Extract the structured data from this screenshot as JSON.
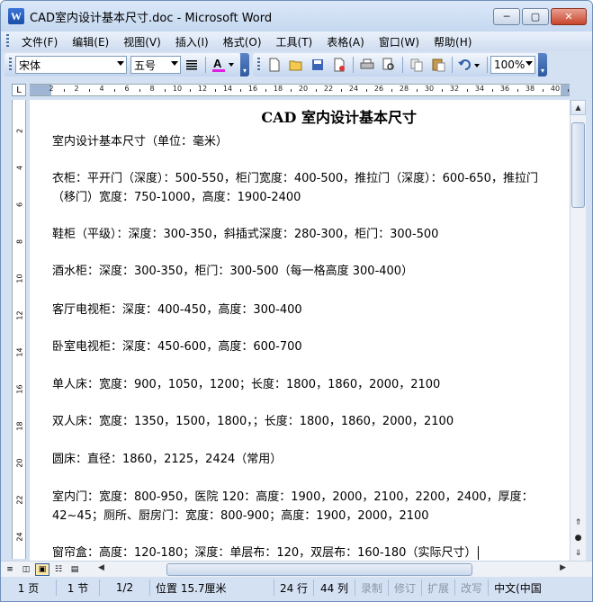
{
  "window": {
    "title": "CAD室内设计基本尺寸.doc - Microsoft Word",
    "app_icon_letter": "W",
    "minimize": "─",
    "maximize": "▢",
    "close": "✕"
  },
  "menu": {
    "items": [
      "文件(F)",
      "编辑(E)",
      "视图(V)",
      "插入(I)",
      "格式(O)",
      "工具(T)",
      "表格(A)",
      "窗口(W)",
      "帮助(H)"
    ],
    "more": "▾"
  },
  "toolbar": {
    "font": "宋体",
    "size": "五号",
    "zoom": "100%",
    "font_color": "#e020e0"
  },
  "ruler": {
    "numbers": [
      "2",
      "2",
      "4",
      "6",
      "8",
      "10",
      "12",
      "14",
      "16",
      "18",
      "20",
      "22",
      "24",
      "26",
      "28",
      "30",
      "32",
      "34",
      "36",
      "38",
      "40"
    ],
    "vnumbers": [
      "2",
      "4",
      "6",
      "8",
      "10",
      "12",
      "14",
      "16",
      "18",
      "20",
      "22",
      "24"
    ],
    "corner": "L"
  },
  "document": {
    "title": "CAD 室内设计基本尺寸",
    "paragraphs": [
      "室内设计基本尺寸（单位：毫米）",
      "衣柜：平开门（深度）：500-550，柜门宽度：400-500，推拉门（深度）：600-650，推拉门（移门）宽度：750-1000，高度：1900-2400",
      "鞋柜（平级）：深度：300-350，斜插式深度：280-300，柜门：300-500",
      "酒水柜：深度：300-350，柜门：300-500（每一格高度 300-400）",
      "客厅电视柜：深度：400-450，高度：300-400",
      "卧室电视柜：深度：450-600，高度：600-700",
      "单人床：宽度：900，1050，1200；长度：1800，1860，2000，2100",
      "双人床：宽度：1350，1500，1800，；长度：1800，1860，2000，2100",
      "圆床：直径：1860，2125，2424（常用）",
      "室内门：宽度：800-950，医院 120：高度：1900，2000，2100，2200，2400，厚度：42~45；厕所、厨房门：宽度：800-900；高度：1900，2000，2100",
      "窗帘盒：高度：120-180；深度：单层布：120，双层布：160-180（实际尺寸）"
    ]
  },
  "status": {
    "page": "1 页",
    "section": "1 节",
    "pages": "1/2",
    "position": "位置 15.7厘米",
    "line": "24 行",
    "column": "44 列",
    "rec": "录制",
    "trk": "修订",
    "ext": "扩展",
    "ovr": "改写",
    "lang": "中文(中国"
  }
}
